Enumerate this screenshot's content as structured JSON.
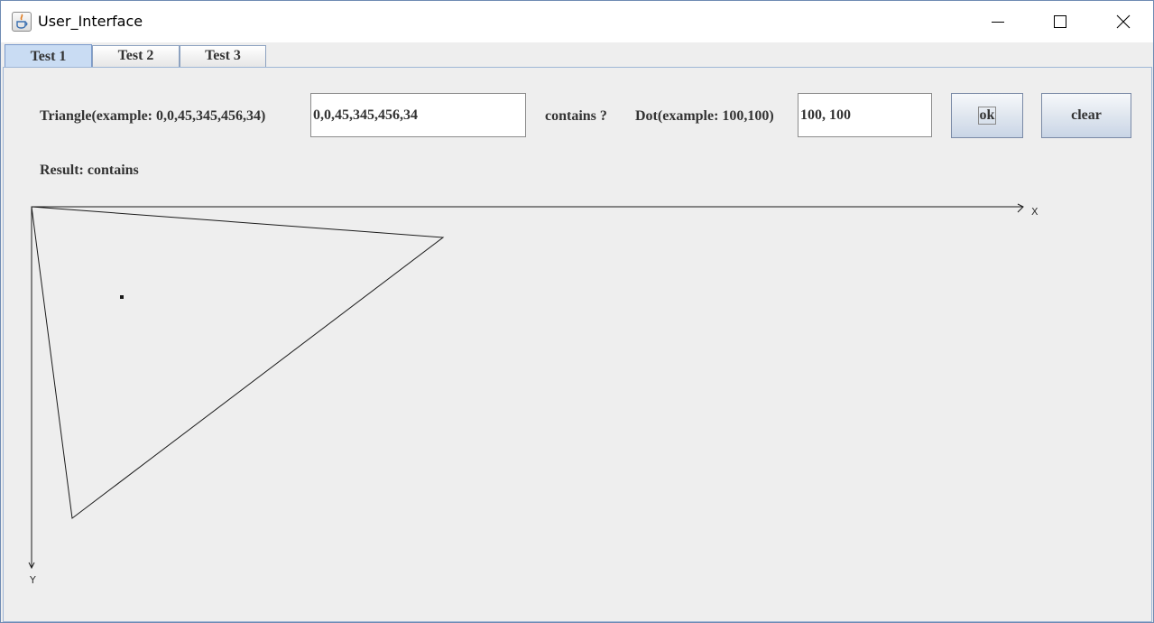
{
  "window": {
    "title": "User_Interface"
  },
  "tabs": [
    {
      "label": "Test 1",
      "active": true
    },
    {
      "label": "Test 2",
      "active": false
    },
    {
      "label": "Test 3",
      "active": false
    }
  ],
  "form": {
    "triangle_label": "Triangle(example: 0,0,45,345,456,34)",
    "triangle_value": "0,0,45,345,456,34",
    "contains_label": "contains ?",
    "dot_label": "Dot(example: 100,100)",
    "dot_value": "100, 100",
    "ok_label": "ok",
    "clear_label": "clear",
    "result_text": "Result: contains"
  },
  "plot": {
    "x_axis_label": "X",
    "y_axis_label": "Y",
    "triangle": [
      [
        0,
        0
      ],
      [
        456,
        34
      ],
      [
        45,
        345
      ]
    ],
    "dot": [
      100,
      100
    ],
    "stroke_color": "#1a1a1a"
  }
}
